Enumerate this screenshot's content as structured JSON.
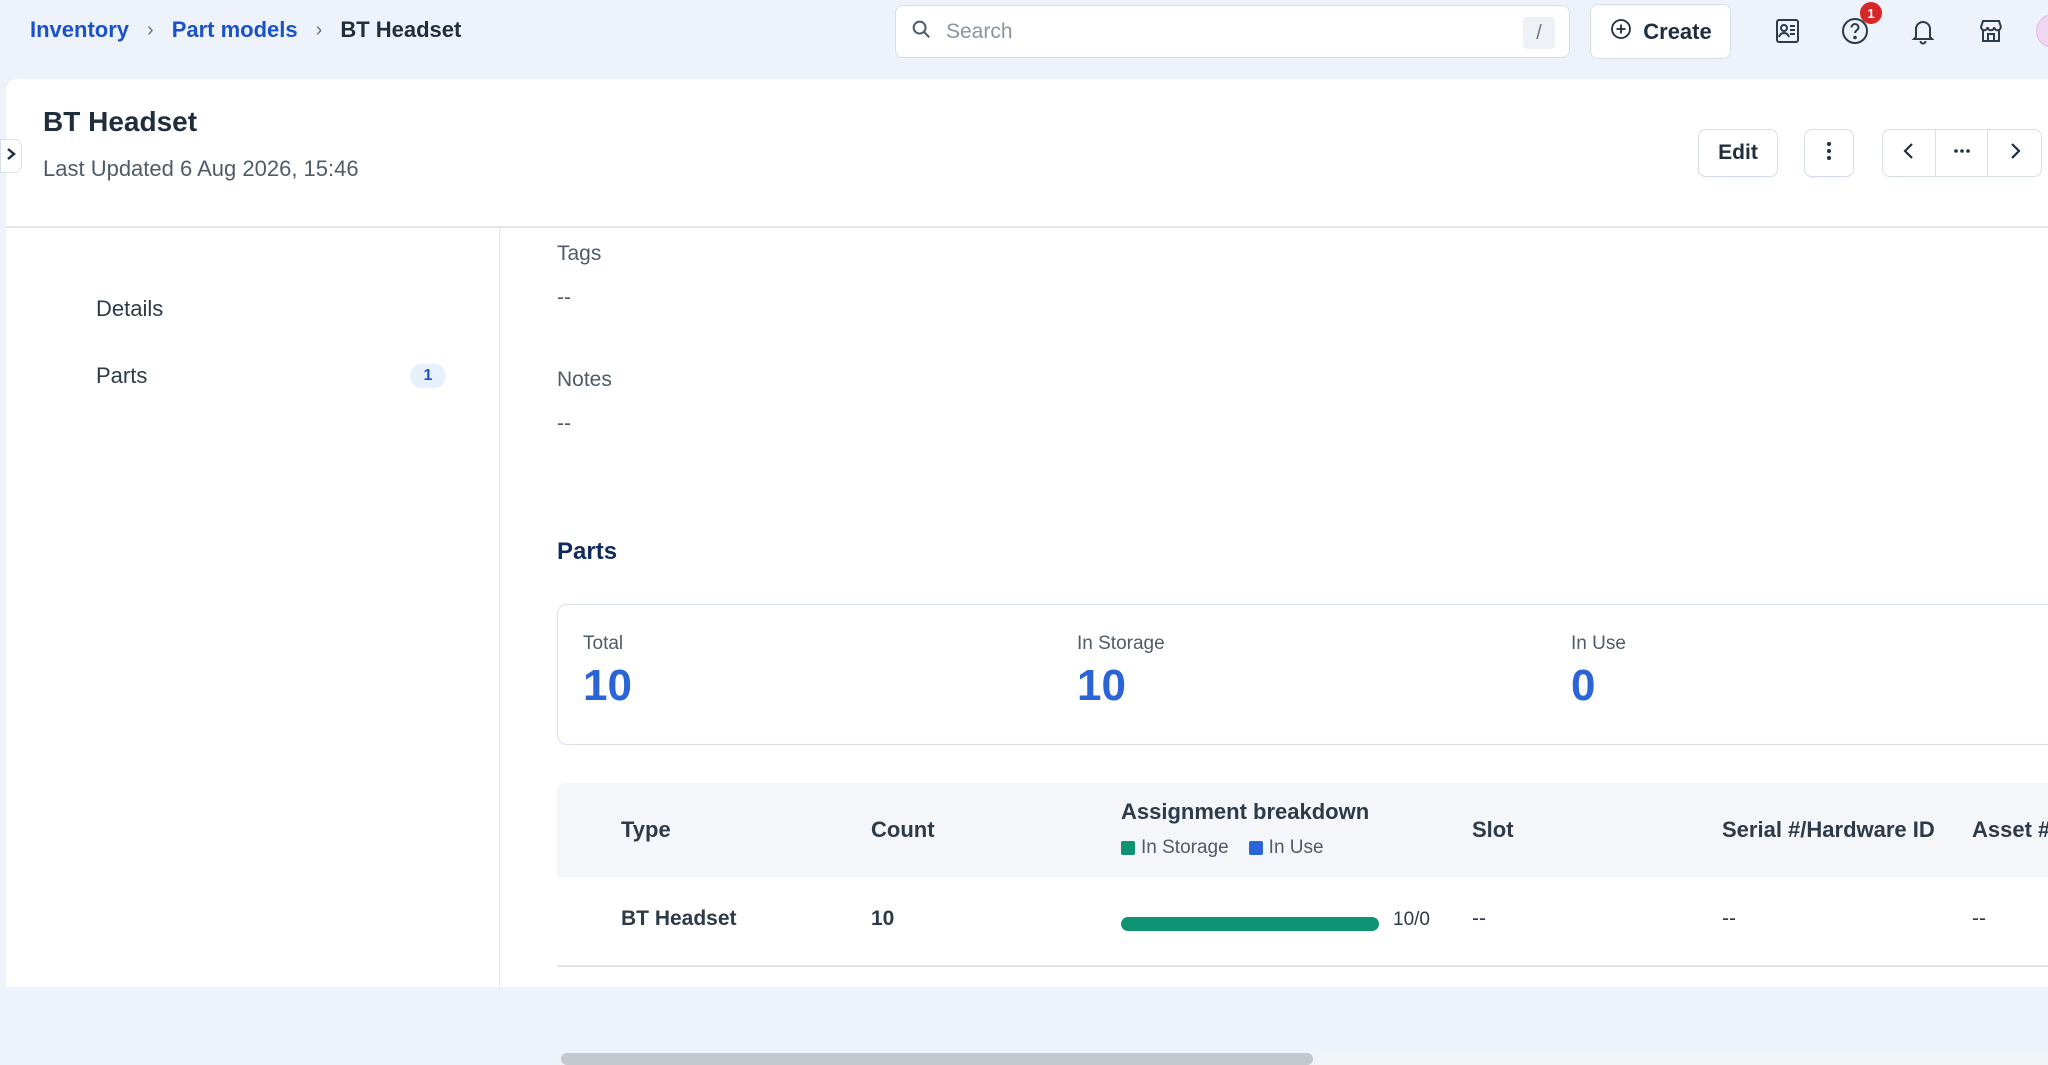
{
  "breadcrumb": {
    "items": [
      "Inventory",
      "Part models"
    ],
    "current": "BT Headset"
  },
  "search": {
    "placeholder": "Search",
    "shortcut": "/"
  },
  "header_actions": {
    "create_label": "Create",
    "help_badge_count": "1",
    "icons": [
      "contacts-list-icon",
      "help-icon",
      "bell-icon",
      "store-icon",
      "avatar"
    ]
  },
  "page": {
    "title": "BT Headset",
    "subtitle": "Last Updated 6 Aug 2026, 15:46",
    "edit_label": "Edit"
  },
  "sidenav": {
    "items": [
      {
        "label": "Details",
        "count": null
      },
      {
        "label": "Parts",
        "count": "1"
      }
    ]
  },
  "details": {
    "tags_label": "Tags",
    "tags_value": "--",
    "notes_label": "Notes",
    "notes_value": "--"
  },
  "parts": {
    "title": "Parts",
    "stats": [
      {
        "label": "Total",
        "value": "10"
      },
      {
        "label": "In Storage",
        "value": "10"
      },
      {
        "label": "In Use",
        "value": "0"
      }
    ],
    "table": {
      "columns": [
        "Type",
        "Count",
        "Assignment breakdown",
        "Slot",
        "Serial #/Hardware ID",
        "Asset #"
      ],
      "legend": [
        {
          "label": "In Storage",
          "color": "#0f9473"
        },
        {
          "label": "In Use",
          "color": "#2a64d6"
        }
      ],
      "rows": [
        {
          "type": "BT Headset",
          "count": "10",
          "in_storage": 10,
          "in_use": 0,
          "breakdown_label": "10/0",
          "slot": "--",
          "serial": "--",
          "asset": "--"
        }
      ]
    }
  },
  "colors": {
    "accent": "#1a52c8",
    "stat_value": "#2a64d6",
    "storage": "#0f9473",
    "in_use": "#2a64d6",
    "badge": "#d62828"
  }
}
